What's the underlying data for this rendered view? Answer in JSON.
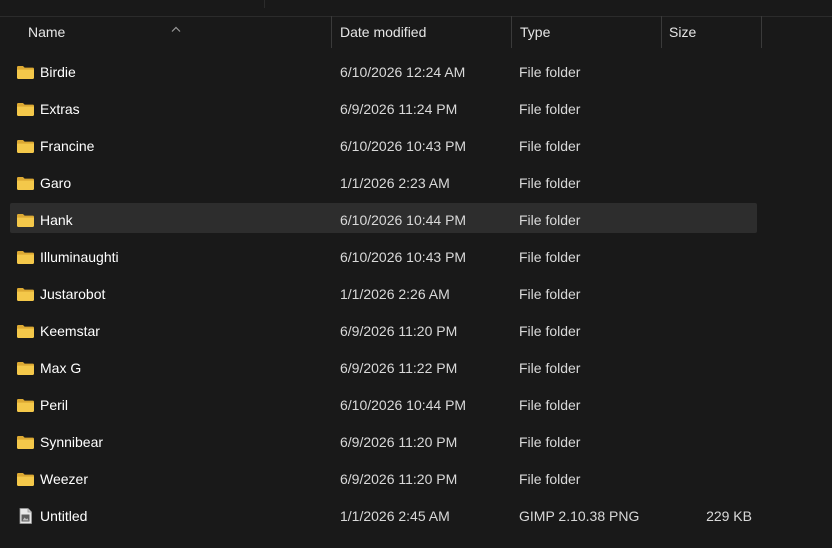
{
  "columns": {
    "name": "Name",
    "date": "Date modified",
    "type": "Type",
    "size": "Size"
  },
  "sort": {
    "column": "name",
    "direction": "ascending",
    "icon": "sort-up-icon"
  },
  "items": [
    {
      "name": "Birdie",
      "date": "6/10/2026 12:24 AM",
      "type": "File folder",
      "size": "",
      "icon": "folder-icon"
    },
    {
      "name": "Extras",
      "date": "6/9/2026 11:24 PM",
      "type": "File folder",
      "size": "",
      "icon": "folder-icon"
    },
    {
      "name": "Francine",
      "date": "6/10/2026 10:43 PM",
      "type": "File folder",
      "size": "",
      "icon": "folder-icon"
    },
    {
      "name": "Garo",
      "date": "1/1/2026 2:23 AM",
      "type": "File folder",
      "size": "",
      "icon": "folder-icon"
    },
    {
      "name": "Hank",
      "date": "6/10/2026 10:44 PM",
      "type": "File folder",
      "size": "",
      "icon": "folder-icon",
      "selected": true
    },
    {
      "name": "Illuminaughti",
      "date": "6/10/2026 10:43 PM",
      "type": "File folder",
      "size": "",
      "icon": "folder-icon"
    },
    {
      "name": "Justarobot",
      "date": "1/1/2026 2:26 AM",
      "type": "File folder",
      "size": "",
      "icon": "folder-icon"
    },
    {
      "name": "Keemstar",
      "date": "6/9/2026 11:20 PM",
      "type": "File folder",
      "size": "",
      "icon": "folder-icon"
    },
    {
      "name": "Max G",
      "date": "6/9/2026 11:22 PM",
      "type": "File folder",
      "size": "",
      "icon": "folder-icon"
    },
    {
      "name": "Peril",
      "date": "6/10/2026 10:44 PM",
      "type": "File folder",
      "size": "",
      "icon": "folder-icon"
    },
    {
      "name": "Synnibear",
      "date": "6/9/2026 11:20 PM",
      "type": "File folder",
      "size": "",
      "icon": "folder-icon"
    },
    {
      "name": "Weezer",
      "date": "6/9/2026 11:20 PM",
      "type": "File folder",
      "size": "",
      "icon": "folder-icon"
    },
    {
      "name": "Untitled",
      "date": "1/1/2026 2:45 AM",
      "type": "GIMP 2.10.38 PNG",
      "size": "229 KB",
      "icon": "gimp-image-file-icon"
    }
  ],
  "colors": {
    "background": "#191919",
    "selected_row": "#2d2d2d",
    "folder": "#f4c84a",
    "folder_dark": "#dca933"
  }
}
